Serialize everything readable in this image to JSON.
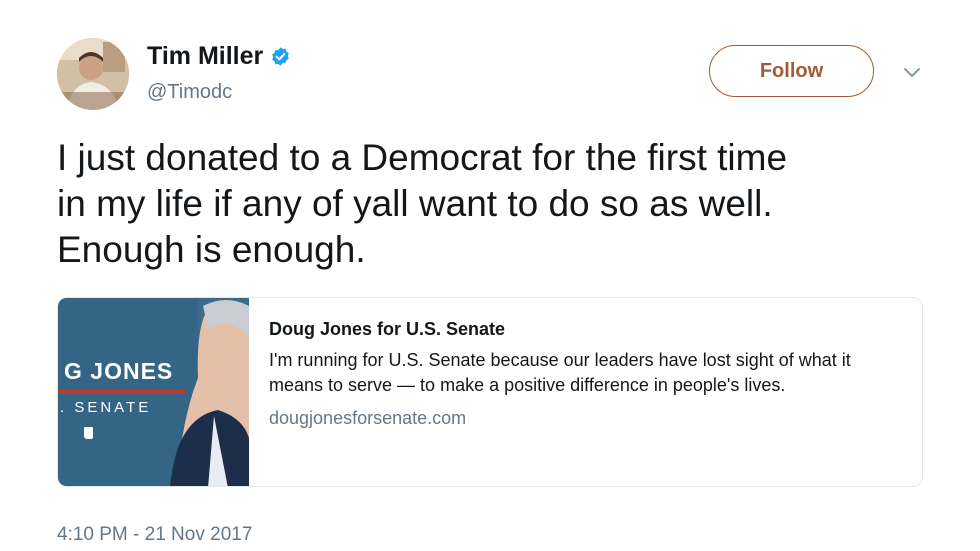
{
  "author": {
    "display_name": "Tim Miller",
    "handle": "@Timodc",
    "verified": true
  },
  "actions": {
    "follow_label": "Follow",
    "menu_icon": "chevron-down-icon"
  },
  "tweet": {
    "text": "I just donated to a Democrat for the first time\nin my life if any of yall want to do so as well.\nEnough is enough.",
    "timestamp": "4:10 PM - 21 Nov 2017"
  },
  "link_card": {
    "title": "Doug Jones for U.S. Senate",
    "description": "I'm running for U.S. Senate because our leaders have lost sight of what it means to serve — to make a positive difference in people's lives.",
    "domain": "dougjonesforsenate.com",
    "image_text_name": "G JONES",
    "image_text_office": ". SENATE"
  },
  "colors": {
    "follow_accent": "#a45a37",
    "verified_blue": "#1da1f2",
    "secondary_text": "#657786",
    "card_border": "#e1e8ed",
    "card_image_bg": "#356584",
    "image_underline_red": "#c0392b"
  }
}
